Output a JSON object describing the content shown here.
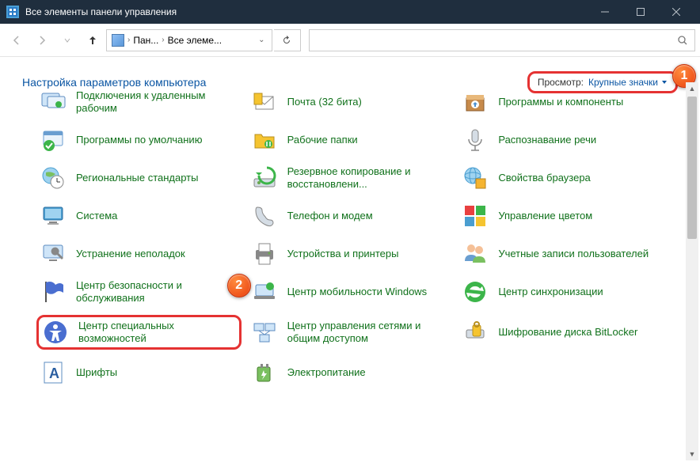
{
  "window": {
    "title": "Все элементы панели управления"
  },
  "breadcrumb": {
    "seg1": "Пан...",
    "seg2": "Все элеме..."
  },
  "header": {
    "title": "Настройка параметров компьютера",
    "viewby_label": "Просмотр:",
    "viewby_value": "Крупные значки"
  },
  "badges": {
    "b1": "1",
    "b2": "2"
  },
  "items": {
    "i0": "Подключения к удаленным рабочим",
    "i1": "Почта (32 бита)",
    "i2": "Программы и компоненты",
    "i3": "Программы по умолчанию",
    "i4": "Рабочие папки",
    "i5": "Распознавание речи",
    "i6": "Региональные стандарты",
    "i7": "Резервное копирование и восстановлени...",
    "i8": "Свойства браузера",
    "i9": "Система",
    "i10": "Телефон и модем",
    "i11": "Управление цветом",
    "i12": "Устранение неполадок",
    "i13": "Устройства и принтеры",
    "i14": "Учетные записи пользователей",
    "i15": "Центр безопасности и обслуживания",
    "i16": "Центр мобильности Windows",
    "i17": "Центр синхронизации",
    "i18": "Центр специальных возможностей",
    "i19": "Центр управления сетями и общим доступом",
    "i20": "Шифрование диска BitLocker",
    "i21": "Шрифты",
    "i22": "Электропитание"
  }
}
